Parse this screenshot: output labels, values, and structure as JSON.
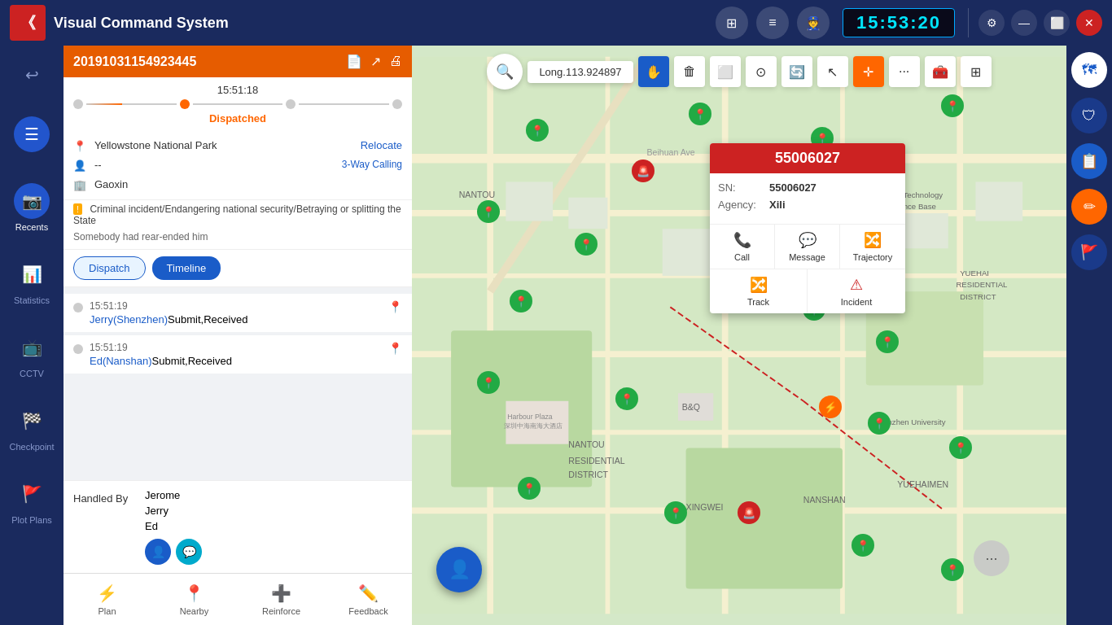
{
  "app": {
    "title": "Visual Command System",
    "clock": "15:53:20"
  },
  "titlebar": {
    "logo": "«",
    "icons": [
      "⊞",
      "≡",
      "👮"
    ],
    "settings_label": "⚙",
    "minimize_label": "—",
    "maximize_label": "⬜",
    "close_label": "✕"
  },
  "sidebar": {
    "back_icon": "↩",
    "items": [
      {
        "icon": "☰",
        "label": "",
        "active": true
      },
      {
        "icon": "📷",
        "label": "Recents",
        "active": true
      },
      {
        "icon": "📊",
        "label": "Statistics",
        "active": false
      },
      {
        "icon": "📺",
        "label": "CCTV",
        "active": false
      },
      {
        "icon": "🏁",
        "label": "Checkpoint",
        "active": false
      },
      {
        "icon": "🚩",
        "label": "Plot Plans",
        "active": false
      }
    ]
  },
  "case": {
    "id": "20191031154923445",
    "time": "15:51:18",
    "status": "Dispatched",
    "location": "Yellowstone National Park",
    "relocate_label": "Relocate",
    "caller": "--",
    "caller_action": "3-Way Calling",
    "org": "Gaoxin",
    "type": "Criminal incident/Endangering national security/Betraying or splitting the State",
    "note": "Somebody had rear-ended him",
    "icon_doc": "📄",
    "icon_export": "↗",
    "icon_print": "🖨"
  },
  "tabs": {
    "dispatch_label": "Dispatch",
    "timeline_label": "Timeline"
  },
  "timeline_events": [
    {
      "time": "15:51:19",
      "text": "Jerry(Shenzhen)Submit,Received",
      "link": "Jerry(Shenzhen)",
      "has_location": true
    },
    {
      "time": "15:51:19",
      "text": "Ed(Nanshan)Submit,Received",
      "link": "Ed(Nanshan)",
      "has_location": true
    }
  ],
  "handled_by": {
    "label": "Handled By",
    "personnel": [
      "Jerome",
      "Jerry",
      "Ed"
    ],
    "avatar_icons": [
      "👤",
      "💬"
    ]
  },
  "bottom_nav": [
    {
      "icon": "⚡",
      "label": "Plan",
      "active": false
    },
    {
      "icon": "📍",
      "label": "Nearby",
      "active": false
    },
    {
      "icon": "➕",
      "label": "Reinforce",
      "active": false
    },
    {
      "icon": "✏️",
      "label": "Feedback",
      "active": false
    }
  ],
  "map": {
    "coord_label": "Long.113.924897",
    "tools": [
      "✋",
      "🗑",
      "⬜",
      "⊙",
      "🔄",
      "↖",
      "✛",
      "···",
      "🧰",
      "⊞"
    ],
    "popup": {
      "title": "55006027",
      "sn_label": "SN:",
      "sn_value": "55006027",
      "agency_label": "Agency:",
      "agency_value": "Xili",
      "actions": [
        {
          "icon": "📞",
          "label": "Call"
        },
        {
          "icon": "💬",
          "label": "Message"
        },
        {
          "icon": "🔀",
          "label": "Trajectory"
        },
        {
          "icon": "🔀",
          "label": "Track"
        },
        {
          "icon": "⚠",
          "label": "Incident"
        }
      ]
    }
  }
}
